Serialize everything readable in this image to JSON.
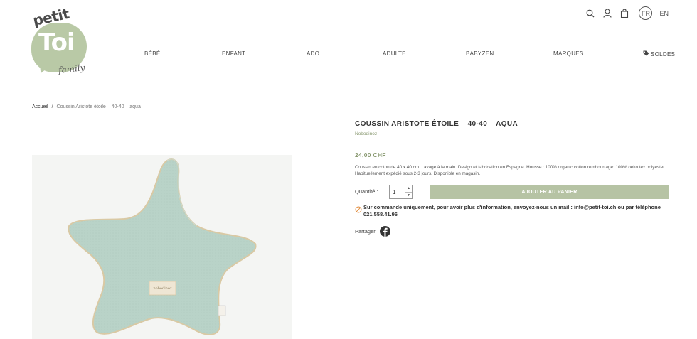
{
  "logo": {
    "line1": "petit",
    "line2": "Toi",
    "line3": "family"
  },
  "header": {
    "lang_active": "FR",
    "lang_other": "EN",
    "icons": [
      "search-icon",
      "user-icon",
      "bag-icon"
    ]
  },
  "nav": {
    "items": [
      {
        "label": "BÉBÉ"
      },
      {
        "label": "ENFANT"
      },
      {
        "label": "ADO"
      },
      {
        "label": "ADULTE"
      },
      {
        "label": "BABYZEN"
      },
      {
        "label": "MARQUES"
      },
      {
        "label": "SOLDES",
        "icon": "tag-icon"
      }
    ]
  },
  "breadcrumb": {
    "home": "Accueil",
    "separator": "/",
    "current": "Coussin Aristote étoile – 40-40 – aqua"
  },
  "product": {
    "title": "COUSSIN ARISTOTE ÉTOILE – 40-40 – AQUA",
    "brand": "Nobodinoz",
    "price": "24,00 CHF",
    "description": "Coussin en coton de 40 x 40 cm. Lavage à la main. Design et fabrication en Espagne. Housse : 100% organic cotton rembourrage: 100% oeko tex polyester Habituellement expédié sous 2-3 jours. Disponible en magasin.",
    "quantity_label": "Quantité :",
    "quantity_value": "1",
    "add_to_cart": "AJOUTER AU PANIER",
    "notice": "Sur commande uniquement, pour avoir plus d'information, envoyez-nous un mail : info@petit-toi.ch ou par téléphone 021.558.41.96",
    "share_label": "Partager",
    "image_label": "nobodinoz"
  },
  "colors": {
    "accent": "#b6c3a4",
    "accent_text": "#8a9a72",
    "star": "#b9d3c8",
    "notice_icon": "#e08a3a"
  }
}
